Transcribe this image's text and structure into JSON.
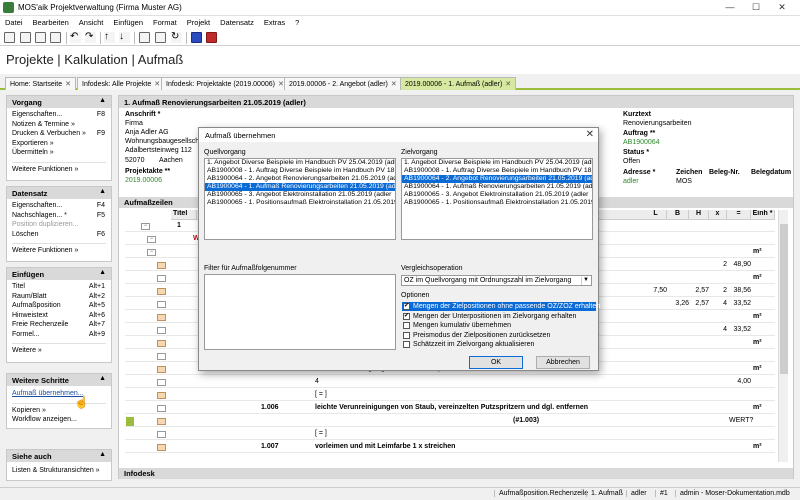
{
  "window": {
    "title": "MOS'aik Projektverwaltung (Firma Muster AG)",
    "minimize": "—",
    "maximize": "☐",
    "close": "✕"
  },
  "menu": [
    "Datei",
    "Bearbeiten",
    "Ansicht",
    "Einfügen",
    "Format",
    "Projekt",
    "Datensatz",
    "Extras",
    "?"
  ],
  "header": {
    "title": "Projekte | Kalkulation | Aufmaß"
  },
  "tabs": [
    {
      "label": "Home: Startseite"
    },
    {
      "label": "Infodesk: Alle Projekte"
    },
    {
      "label": "Infodesk: Projektakte (2019.00006)"
    },
    {
      "label": "2019.00006 - 2. Angebot (adler)"
    },
    {
      "label": "2019.00006 - 1. Aufmaß (adler)"
    }
  ],
  "tab_close": "✕",
  "sidebar": {
    "vorgang": {
      "title": "Vorgang",
      "items": [
        {
          "label": "Eigenschaften...",
          "key": "F8"
        },
        {
          "label": "Notizen & Termine »",
          "key": ""
        },
        {
          "label": "Drucken & Verbuchen »",
          "key": "F9"
        },
        {
          "label": "Exportieren »",
          "key": ""
        },
        {
          "label": "Übermitteln »",
          "key": ""
        }
      ],
      "more": "Weitere Funktionen »"
    },
    "datensatz": {
      "title": "Datensatz",
      "items": [
        {
          "label": "Eigenschaften...",
          "key": "F4"
        },
        {
          "label": "Nachschlagen... *",
          "key": "F5"
        },
        {
          "label": "Position duplizieren...",
          "key": ""
        },
        {
          "label": "Löschen",
          "key": "F6"
        }
      ],
      "more": "Weitere Funktionen »"
    },
    "einfuegen": {
      "title": "Einfügen",
      "items": [
        {
          "label": "Titel",
          "key": "Alt+1"
        },
        {
          "label": "Raum/Blatt",
          "key": "Alt+2"
        },
        {
          "label": "Aufmaßposition",
          "key": "Alt+5"
        },
        {
          "label": "Hinweistext",
          "key": "Alt+6"
        },
        {
          "label": "Freie Rechenzeile",
          "key": "Alt+7"
        },
        {
          "label": "Formel...",
          "key": "Alt+9"
        }
      ],
      "more": "Weitere »"
    },
    "weitere": {
      "title": "Weitere Schritte",
      "items": [
        {
          "label": "Aufmaß übernehmen..."
        },
        {
          "label": "Kopieren »"
        },
        {
          "label": "Workflow anzeigen..."
        }
      ]
    },
    "siehe": {
      "title": "Siehe auch",
      "items": [
        {
          "label": "Listen & Strukturansichten »"
        }
      ]
    },
    "caret": "▲"
  },
  "main": {
    "title": "1. Aufmaß Renovierungsarbeiten 21.05.2019 (adler)",
    "anschrift_label": "Anschrift *",
    "anschrift": [
      "Firma",
      "Anja Adler AG",
      "Wohnungsbaugesellsch...",
      "Adalbertsteinweg 112"
    ],
    "plz": "52070",
    "ort": "Aachen",
    "projektakte_label": "Projektakte **",
    "projektakte": "2019.00006",
    "kurztext_label": "Kurztext",
    "kurztext": "Renovierungsarbeiten",
    "auftrag_label": "Auftrag **",
    "auftrag": "AB1900064",
    "status_label": "Status *",
    "status": "Offen",
    "adresse_label": "Adresse *",
    "adresse": "adler",
    "zeichen_label": "Zeichen",
    "zeichen": "MOS",
    "belegnr_label": "Beleg-Nr.",
    "belegdatum_label": "Belegdatum",
    "aufmasszeilen": "Aufmaßzeilen",
    "infodesk": "Infodesk",
    "grid": {
      "cols": [
        "Titel",
        "L",
        "B",
        "H",
        "x",
        "=",
        "Einh *"
      ],
      "rows": [
        {
          "nr": "1",
          "text": "",
          "vals": [
            "",
            "",
            "",
            "",
            "",
            ""
          ]
        },
        {
          "nr": "",
          "text": "W",
          "vals": [
            "",
            "",
            "",
            "",
            "",
            ""
          ]
        },
        {
          "nr": "",
          "text": "ch entfern...",
          "vals": [
            "",
            "",
            "",
            "",
            "",
            "m²"
          ]
        },
        {
          "nr": "",
          "text": "",
          "vals": [
            "",
            "",
            "",
            "2",
            "48,90",
            ""
          ]
        },
        {
          "nr": "",
          "text": "",
          "vals": [
            "",
            "",
            "",
            "",
            "",
            "m²"
          ]
        },
        {
          "nr": "",
          "text": "",
          "vals": [
            "7,50",
            "",
            "2,57",
            "2",
            "38,56",
            ""
          ]
        },
        {
          "nr": "",
          "text": "",
          "vals": [
            "",
            "3,26",
            "2,57",
            "4",
            "33,52",
            ""
          ]
        },
        {
          "nr": "",
          "text": "hten und a...",
          "vals": [
            "",
            "",
            "",
            "",
            "",
            "m²"
          ]
        },
        {
          "nr": "",
          "text": "",
          "vals": [
            "",
            "",
            "",
            "4",
            "33,52",
            ""
          ]
        },
        {
          "nr": "",
          "text": "entfernen...",
          "vals": [
            "",
            "",
            "",
            "",
            "",
            "m²"
          ]
        },
        {
          "nr": "",
          "text": "",
          "vals": [
            "",
            "",
            "",
            "",
            "",
            ""
          ]
        },
        {
          "nr": "1.005",
          "text": "kleine Beschädigungen am Putz beispachteln",
          "vals": [
            "",
            "",
            "",
            "",
            "",
            "m²"
          ]
        },
        {
          "nr": "",
          "text": "4",
          "vals": [
            "",
            "",
            "",
            "",
            "4,00",
            ""
          ]
        },
        {
          "nr": "",
          "text": "[ = ]",
          "vals": [
            "",
            "",
            "",
            "",
            "",
            ""
          ]
        },
        {
          "nr": "1.006",
          "text": "leichte Verunreinigungen von Staub, vereinzelten Putzspritzern und dgl. entfernen",
          "vals": [
            "",
            "",
            "",
            "",
            "",
            "m²"
          ]
        },
        {
          "nr": "",
          "text": "(#1.003)",
          "vals": [
            "",
            "",
            "",
            "",
            "WERT?",
            ""
          ]
        },
        {
          "nr": "",
          "text": "[ = ]",
          "vals": [
            "",
            "",
            "",
            "",
            "",
            ""
          ]
        },
        {
          "nr": "1.007",
          "text": "vorleimen und mit Leimfarbe 1 x streichen",
          "vals": [
            "",
            "",
            "",
            "",
            "",
            "m²"
          ]
        }
      ]
    }
  },
  "dialog": {
    "title": "Aufmaß übernehmen",
    "close": "✕",
    "quell_label": "Quellvorgang",
    "quell": [
      "1. Angebot Diverse Beispiele im Handbuch PV 25.04.2019 (adle",
      "AB1900008 - 1. Auftrag Diverse Beispiele im Handbuch PV 18.0",
      "AB1900064 - 2. Angebot Renovierungsarbeiten 21.05.2019 (adl",
      "AB1900064 - 1. Aufmaß Renovierungsarbeiten 21.05.2019 (adl",
      "AB1900065 - 3. Angebot Elektroinstallation 21.05.2019 (adler",
      "AB1900065 - 1. Positionsaufmaß Elektroinstallation 21.05.2019"
    ],
    "quell_sel": 3,
    "ziel_label": "Zielvorgang",
    "ziel": [
      "1. Angebot Diverse Beispiele im Handbuch PV 25.04.2019 (adle",
      "AB1900008 - 1. Auftrag Diverse Beispiele im Handbuch PV 18.0",
      "AB1900064 - 2. Angebot Renovierungsarbeiten 21.05.2019 (ad",
      "AB1900064 - 1. Aufmaß Renovierungsarbeiten 21.05.2019 (adle",
      "AB1900065 - 3. Angebot Elektroinstallation 21.05.2019 (adler",
      "AB1900065 - 1. Positionsaufmaß Elektroinstallation 21.05.2019"
    ],
    "ziel_sel": 2,
    "filter_label": "Filter für Aufmaßfolgenummer",
    "vergleich_label": "Vergleichsoperation",
    "vergleich": "OZ im Quellvorgang mit Ordnungszahl im Zielvorgang",
    "optionen_label": "Optionen",
    "optionen": [
      {
        "label": "Mengen der Zielpositionen ohne passende OZ/ZOZ erhalten",
        "checked": true,
        "sel": true
      },
      {
        "label": "Mengen der Unterpositionen im Zielvorgang erhalten",
        "checked": true,
        "sel": false
      },
      {
        "label": "Mengen kumulativ übernehmen",
        "checked": false,
        "sel": false
      },
      {
        "label": "Preismodus der Zielpositionen zurücksetzen",
        "checked": false,
        "sel": false
      },
      {
        "label": "Schätzzeit im Zielvorgang aktualisieren",
        "checked": false,
        "sel": false
      }
    ],
    "ok": "OK",
    "cancel": "Abbrechen"
  },
  "statusbar": [
    "Aufmaßposition.Rechenzeile",
    "1. Aufmaß",
    "adler",
    "#1",
    "admin - Moser-Dokumentation.mdb"
  ]
}
